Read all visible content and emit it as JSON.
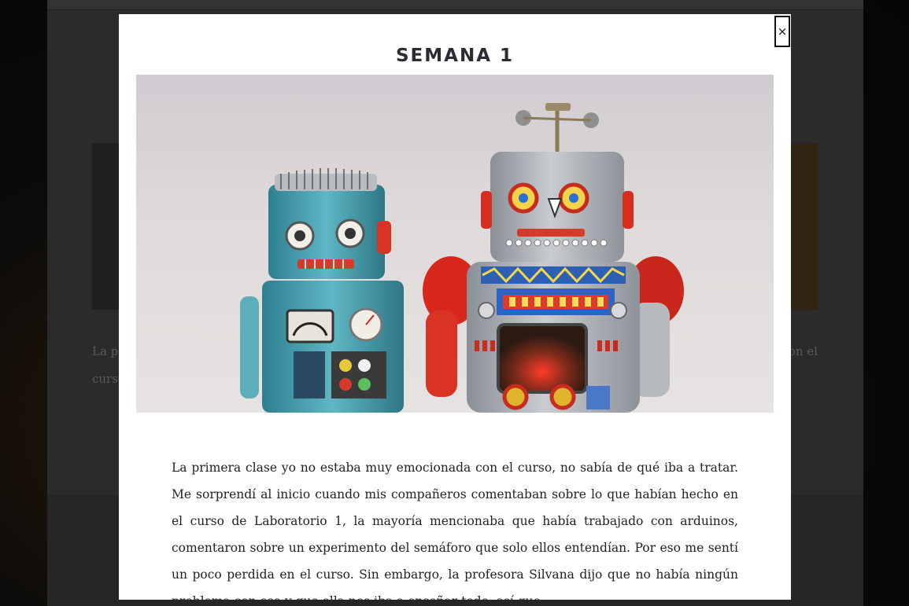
{
  "modal": {
    "title": "SEMANA 1",
    "close_label": "×",
    "image_alt": "Two vintage tin toy robots",
    "paragraph": "La primera clase yo no estaba muy emocionada con el curso, no sabía de qué iba a tratar. Me sorprendí al inicio cuando mis compañeros comentaban sobre lo que habían hecho en el curso de Laboratorio 1, la mayoría mencionaba que había trabajado con arduinos, comentaron sobre un experimento del semáforo que solo ellos entendían. Por eso me sentí un poco perdida en el curso. Sin embargo, la profesora Silvana dijo que no había ningún problema con eso y que ella nos iba a enseñar todo, así que"
  },
  "background": {
    "text_line1": "La p",
    "text_line2": "curso",
    "text_right": "con el"
  },
  "colors": {
    "modal_bg": "#ffffff",
    "overlay": "#2b2b2b",
    "title": "#2b2b33",
    "body_text": "#222222"
  }
}
